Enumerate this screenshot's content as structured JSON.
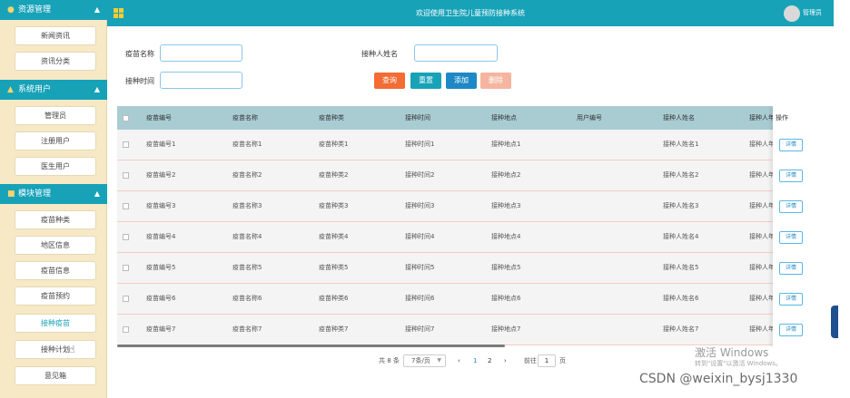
{
  "header": {
    "title": "欢迎使用卫生院儿童预防接种系统",
    "user_label": "管理员"
  },
  "sidebar": {
    "groups": [
      {
        "label": "资源管理",
        "items": [
          "新闻资讯",
          "资讯分类"
        ]
      },
      {
        "label": "系统用户",
        "items": [
          "管理员",
          "注册用户",
          "医生用户"
        ]
      },
      {
        "label": "模块管理",
        "items": [
          "疫苗种类",
          "地区信息",
          "疫苗信息",
          "疫苗预约",
          "接种疫苗",
          "接种计划",
          "意见箱"
        ]
      }
    ],
    "active_item": "接种疫苗"
  },
  "search": {
    "vaccine_name_label": "疫苗名称",
    "vaccine_name_value": "",
    "person_name_label": "接种人姓名",
    "person_name_value": "",
    "time_label": "接种时间",
    "time_value": ""
  },
  "buttons": {
    "search": "查询",
    "reset": "重置",
    "add": "添加",
    "delete": "删除"
  },
  "table": {
    "columns": [
      "疫苗编号",
      "疫苗名称",
      "疫苗种类",
      "接种时间",
      "接种地点",
      "用户编号",
      "接种人姓名",
      "接种人年",
      "操作"
    ],
    "rows": [
      [
        "疫苗编号1",
        "疫苗名称1",
        "疫苗种类1",
        "接种时间1",
        "接种地点1",
        "",
        "接种人姓名1",
        "接种人年"
      ],
      [
        "疫苗编号2",
        "疫苗名称2",
        "疫苗种类2",
        "接种时间2",
        "接种地点2",
        "",
        "接种人姓名2",
        "接种人年"
      ],
      [
        "疫苗编号3",
        "疫苗名称3",
        "疫苗种类3",
        "接种时间3",
        "接种地点3",
        "",
        "接种人姓名3",
        "接种人年"
      ],
      [
        "疫苗编号4",
        "疫苗名称4",
        "疫苗种类4",
        "接种时间4",
        "接种地点4",
        "",
        "接种人姓名4",
        "接种人年"
      ],
      [
        "疫苗编号5",
        "疫苗名称5",
        "疫苗种类5",
        "接种时间5",
        "接种地点5",
        "",
        "接种人姓名5",
        "接种人年"
      ],
      [
        "疫苗编号6",
        "疫苗名称6",
        "疫苗种类6",
        "接种时间6",
        "接种地点6",
        "",
        "接种人姓名6",
        "接种人年"
      ],
      [
        "疫苗编号7",
        "疫苗名称7",
        "疫苗种类7",
        "接种时间7",
        "接种地点7",
        "",
        "接种人姓名7",
        "接种人年"
      ]
    ],
    "detail_label": "详情"
  },
  "pagination": {
    "total": "共 8 条",
    "page_size": "7条/页",
    "prev": "‹",
    "pages": [
      "1",
      "2"
    ],
    "next": "›",
    "goto_label": "前往",
    "goto_value": "1",
    "page_unit": "页"
  },
  "watermark": {
    "activate_title": "激活 Windows",
    "activate_sub": "转到\"设置\"以激活 Windows。",
    "csdn": "CSDN @weixin_bysj1330"
  },
  "colors": {
    "primary": "#17a2b8",
    "sidebar_bg": "#f7e9c6",
    "search_button": "#f26c34",
    "add_button": "#1e88c6",
    "delete_button": "#f5b5a0",
    "table_header": "#a9ccd3"
  }
}
